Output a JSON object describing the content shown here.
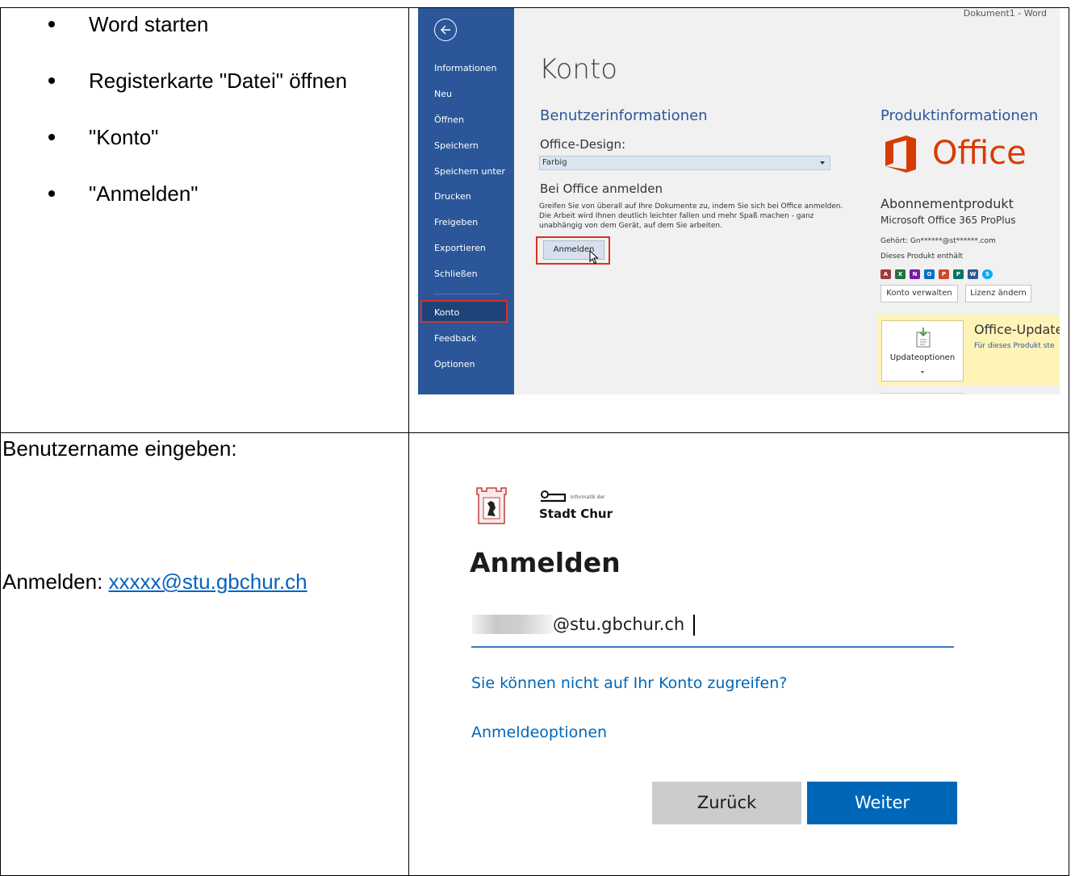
{
  "steps": {
    "items": [
      "Word starten",
      "Registerkarte \"Datei\" öffnen",
      "\"Konto\"",
      "\"Anmelden\""
    ]
  },
  "row2": {
    "heading": "Benutzername eingeben:",
    "login_label": "Anmelden: ",
    "login_email": "xxxxx@stu.gbchur.ch"
  },
  "word": {
    "window_title": "Dokument1  -  Word",
    "nav": [
      "Informationen",
      "Neu",
      "Öffnen",
      "Speichern",
      "Speichern unter",
      "Drucken",
      "Freigeben",
      "Exportieren",
      "Schließen"
    ],
    "nav_bottom": [
      "Konto",
      "Feedback",
      "Optionen"
    ],
    "page_title": "Konto",
    "user_info_heading": "Benutzerinformationen",
    "design_label": "Office-Design:",
    "design_value": "Farbig",
    "signin_heading": "Bei Office anmelden",
    "signin_text": "Greifen Sie von überall auf Ihre Dokumente zu, indem Sie sich bei Office anmelden. Die Arbeit wird Ihnen deutlich leichter fallen und mehr Spaß machen - ganz unabhängig von dem Gerät, auf dem Sie arbeiten.",
    "signin_button": "Anmelden",
    "product_heading": "Produktinformationen",
    "office_brand": "Office",
    "subscription_heading": "Abonnementprodukt",
    "product_name": "Microsoft Office 365 ProPlus",
    "owner": "Gehört: Gn******@st******.com",
    "contains": "Dieses Produkt enthält",
    "apps": [
      {
        "letter": "A",
        "color": "#a4373a"
      },
      {
        "letter": "X",
        "color": "#217346"
      },
      {
        "letter": "N",
        "color": "#7719aa"
      },
      {
        "letter": "O",
        "color": "#0072c6"
      },
      {
        "letter": "P",
        "color": "#d24726"
      },
      {
        "letter": "P",
        "color": "#077568"
      },
      {
        "letter": "W",
        "color": "#2b579a"
      },
      {
        "letter": "S",
        "color": "#00aff0"
      }
    ],
    "manage_account": "Konto verwalten",
    "change_license": "Lizenz ändern",
    "update_options": "Updateoptionen",
    "update_title": "Office-Update",
    "update_sub": "Für dieses Produkt ste"
  },
  "signin": {
    "org_small": "Informatik der",
    "org_name": "Stadt Chur",
    "title": "Anmelden",
    "email_suffix": "@stu.gbchur.ch",
    "cant_access": "Sie können nicht auf Ihr Konto zugreifen?",
    "options": "Anmeldeoptionen",
    "back": "Zurück",
    "next": "Weiter"
  }
}
